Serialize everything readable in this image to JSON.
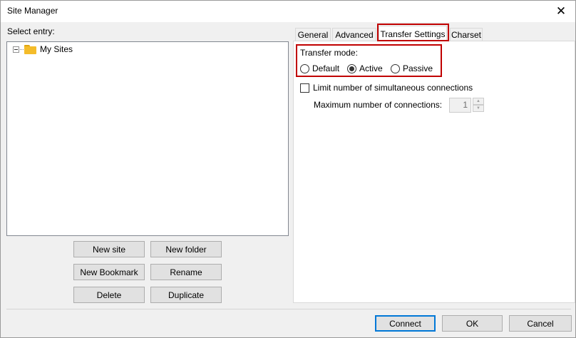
{
  "window": {
    "title": "Site Manager",
    "close_icon": "close-icon"
  },
  "left": {
    "select_entry_label": "Select entry:",
    "tree": [
      {
        "label": "My Sites",
        "icon": "folder-icon",
        "expanded": true
      }
    ],
    "buttons": {
      "new_site": "New site",
      "new_folder": "New folder",
      "new_bookmark": "New Bookmark",
      "rename": "Rename",
      "delete": "Delete",
      "duplicate": "Duplicate"
    }
  },
  "tabs": [
    {
      "label": "General",
      "active": false
    },
    {
      "label": "Advanced",
      "active": false
    },
    {
      "label": "Transfer Settings",
      "active": true
    },
    {
      "label": "Charset",
      "active": false
    }
  ],
  "transfer": {
    "mode_label": "Transfer mode:",
    "modes": [
      {
        "label": "Default",
        "selected": false
      },
      {
        "label": "Active",
        "selected": true
      },
      {
        "label": "Passive",
        "selected": false
      }
    ],
    "limit_label": "Limit number of simultaneous connections",
    "limit_checked": false,
    "max_label": "Maximum number of connections:",
    "max_value": "1"
  },
  "footer": {
    "connect": "Connect",
    "ok": "OK",
    "cancel": "Cancel"
  },
  "colors": {
    "highlight": "#c00000",
    "folder": "#f4bc2a",
    "default_button_border": "#0078d7"
  }
}
